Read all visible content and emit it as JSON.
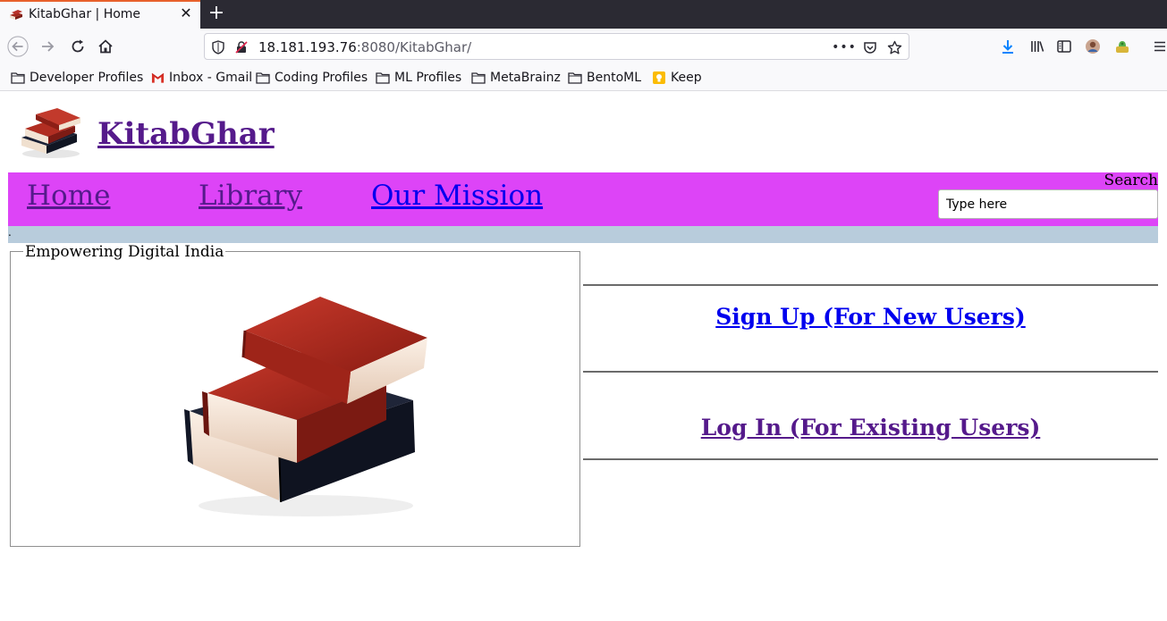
{
  "browser": {
    "tab_title": "KitabGhar | Home",
    "new_tab_label": "+",
    "url_host": "18.181.193.76",
    "url_rest": ":8080/KitabGhar/",
    "page_actions_label": "•••"
  },
  "bookmarks": [
    {
      "label": "Developer Profiles",
      "icon": "folder-icon"
    },
    {
      "label": "Inbox - Gmail",
      "icon": "gmail-icon"
    },
    {
      "label": "Coding Profiles",
      "icon": "folder-icon"
    },
    {
      "label": "ML Profiles",
      "icon": "folder-icon"
    },
    {
      "label": "MetaBrainz",
      "icon": "folder-icon"
    },
    {
      "label": "BentoML",
      "icon": "folder-icon"
    },
    {
      "label": "Keep",
      "icon": "keep-icon"
    }
  ],
  "site": {
    "title": "KitabGhar",
    "menu": {
      "home": "Home",
      "library": "Library",
      "mission": "Our Mission"
    },
    "search": {
      "label": "Search",
      "placeholder": "Type here"
    },
    "strip_text": ".",
    "fieldset_legend": "Empowering Digital India",
    "signup": "Sign Up (For New Users)",
    "login": "Log In (For Existing Users)"
  },
  "colors": {
    "menu_bg": "#dd44f7",
    "strip_bg": "#b8ccdc",
    "visited_link": "#551a8b",
    "link": "#0000ee"
  }
}
